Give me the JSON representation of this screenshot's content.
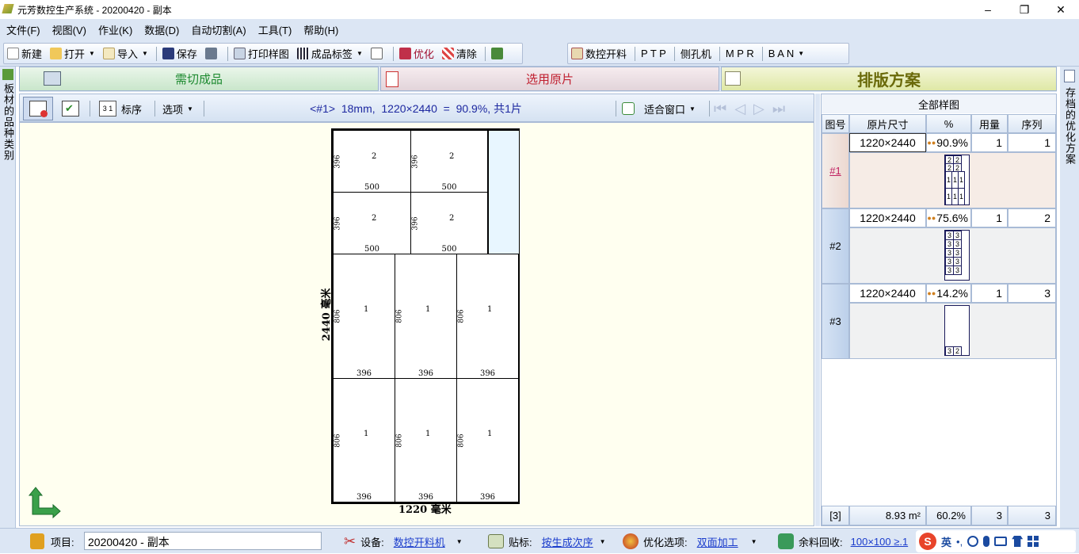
{
  "window": {
    "title": "元芳数控生产系统 - 20200420 - 副本",
    "min": "–",
    "max": "❐",
    "close": "✕"
  },
  "menu": [
    "文件(F)",
    "视图(V)",
    "作业(K)",
    "数据(D)",
    "自动切割(A)",
    "工具(T)",
    "帮助(H)"
  ],
  "toolbar": {
    "new": "新建",
    "open": "打开",
    "import": "导入",
    "save": "保存",
    "print_sample": "打印样图",
    "product_label": "成品标签",
    "optimize": "优化",
    "clear": "清除"
  },
  "toolbar_machines": {
    "cnc": "数控开料",
    "ptp": "P T P",
    "side": "侧孔机",
    "mpr": "M P R",
    "ban": "B A N"
  },
  "left_strip": "板材的品种类别",
  "right_strip": "存档的优化方案",
  "tabs": {
    "tab1": "需切成品",
    "tab2": "选用原片",
    "tab3": "排版方案"
  },
  "inner_toolbar": {
    "seq": "标序",
    "options": "选项",
    "info": "<#1>  18mm,  1220×2440  =  90.9%, 共1片",
    "fit": "适合窗口"
  },
  "drawing": {
    "sheet_width_label": "1220 毫米",
    "sheet_height_label": "2440 毫米",
    "top_parts": [
      {
        "qty": "2",
        "w": "500",
        "h": "396"
      },
      {
        "qty": "2",
        "w": "500",
        "h": "396"
      },
      {
        "qty": "2",
        "w": "500",
        "h": "396"
      },
      {
        "qty": "2",
        "w": "500",
        "h": "396"
      }
    ],
    "bottom_parts": [
      {
        "qty": "1",
        "w": "396",
        "h": "806"
      },
      {
        "qty": "1",
        "w": "396",
        "h": "806"
      },
      {
        "qty": "1",
        "w": "396",
        "h": "806"
      },
      {
        "qty": "1",
        "w": "396",
        "h": "806"
      },
      {
        "qty": "1",
        "w": "396",
        "h": "806"
      },
      {
        "qty": "1",
        "w": "396",
        "h": "806"
      }
    ]
  },
  "right_panel": {
    "title": "全部样图",
    "columns": [
      "图号",
      "原片尺寸",
      "%",
      "用量",
      "序列"
    ],
    "rows": [
      {
        "id": "#1",
        "size": "1220×2440",
        "pct": "90.9%",
        "qty": "1",
        "seq": "1"
      },
      {
        "id": "#2",
        "size": "1220×2440",
        "pct": "75.6%",
        "qty": "1",
        "seq": "2"
      },
      {
        "id": "#3",
        "size": "1220×2440",
        "pct": "14.2%",
        "qty": "1",
        "seq": "3"
      }
    ],
    "footer": {
      "count": "[3]",
      "area": "8.93 m²",
      "pct": "60.2%",
      "qty": "3",
      "seq": "3"
    }
  },
  "statusbar": {
    "project_label": "项目:",
    "project_value": "20200420 - 副本",
    "device_label": "设备:",
    "device_value": "数控开料机",
    "label_label": "贴标:",
    "label_value": "按生成次序",
    "opt_label": "优化选项:",
    "opt_value": "双面加工",
    "rest_label": "余料回收:",
    "rest_value": "100×100 ≥.1"
  },
  "ime": {
    "lang": "英",
    "punct": "•,"
  }
}
